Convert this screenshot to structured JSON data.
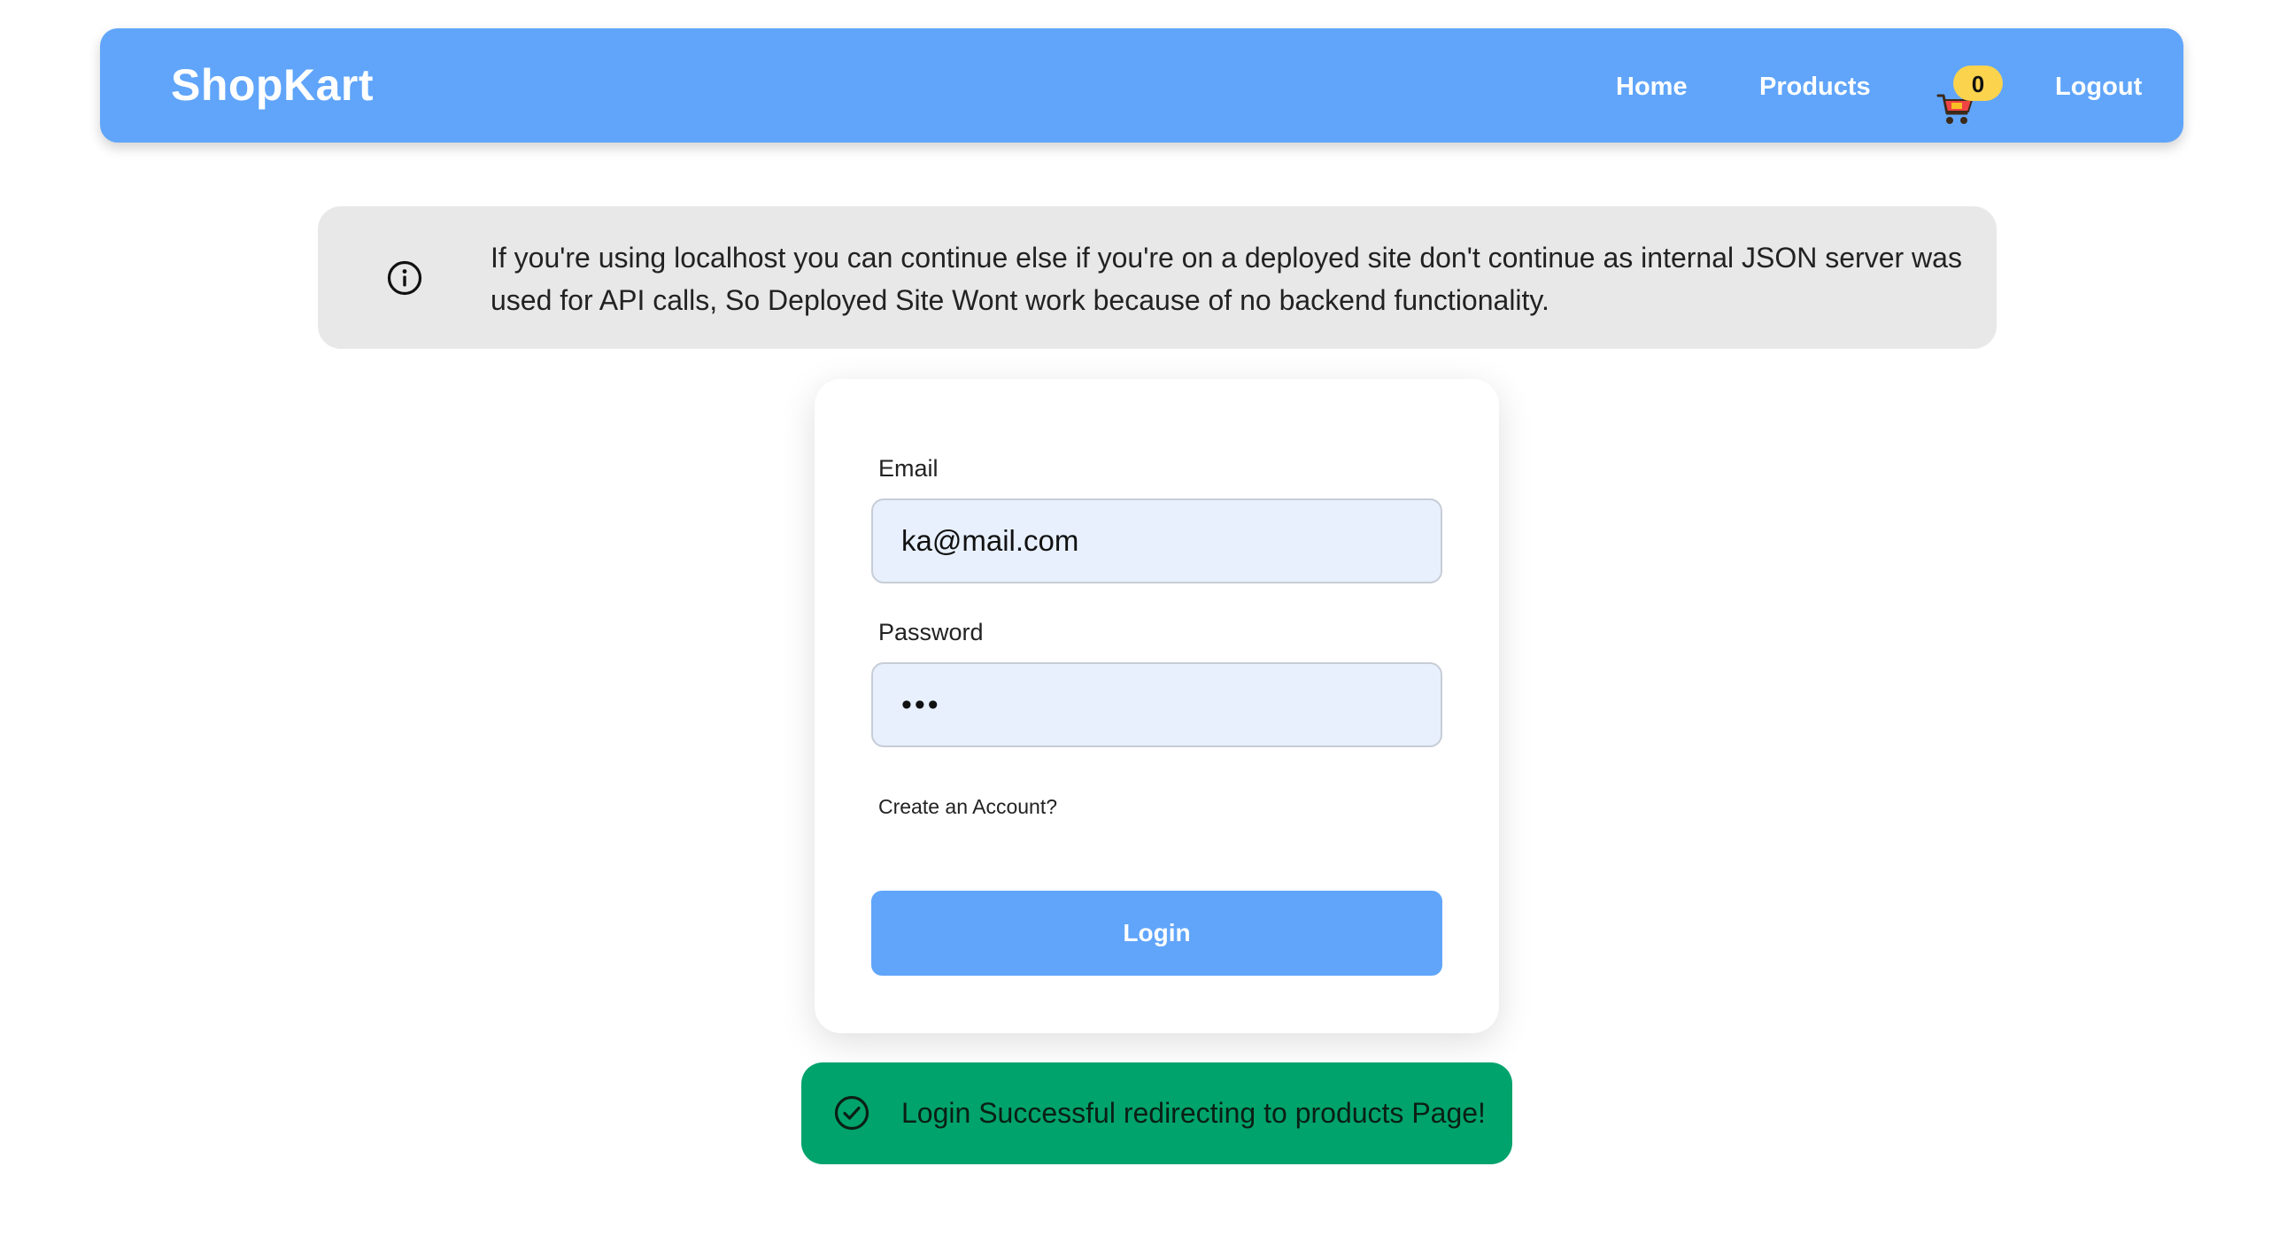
{
  "navbar": {
    "brand": "ShopKart",
    "links": {
      "home": "Home",
      "products": "Products",
      "logout": "Logout"
    },
    "cart": {
      "icon": "shopping-cart-icon",
      "count": "0"
    }
  },
  "info_alert": {
    "icon": "info-icon",
    "text": "If you're using localhost you can continue else if you're on a deployed site don't continue as internal JSON server was used for API calls, So Deployed Site Wont work because of no backend functionality."
  },
  "login_form": {
    "email_label": "Email",
    "email_value": "ka@mail.com",
    "password_label": "Password",
    "password_value": "abc",
    "create_account_link": "Create an Account?",
    "login_button": "Login"
  },
  "toast": {
    "icon": "check-circle-icon",
    "message": "Login Successful redirecting to products Page!"
  },
  "colors": {
    "primary": "#60a5fa",
    "info_bg": "#e8e8e8",
    "input_bg": "#e8f0fe",
    "success": "#00a36c",
    "badge": "#fcd34d"
  }
}
